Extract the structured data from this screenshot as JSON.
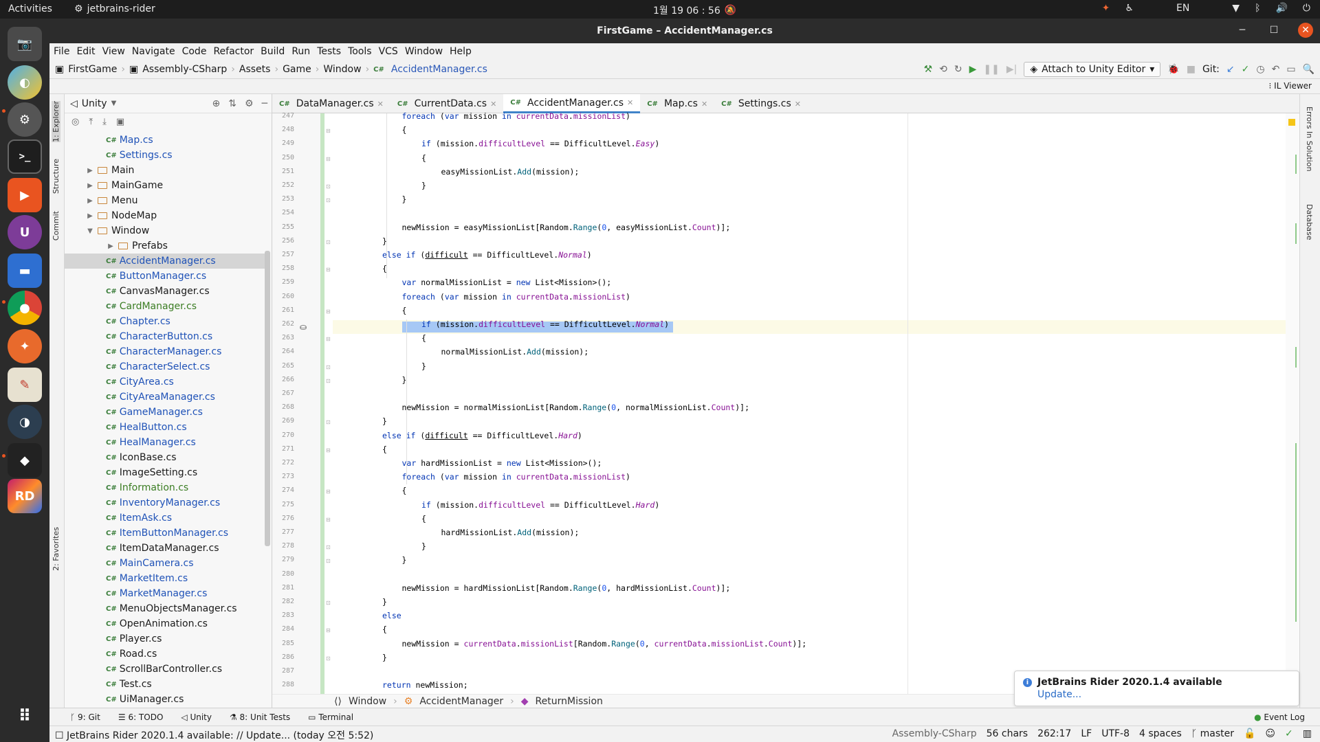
{
  "topbar": {
    "activities": "Activities",
    "app": "jetbrains-rider",
    "clock": "1월 19  06 : 56",
    "lang": "EN"
  },
  "window": {
    "title": "FirstGame – AccidentManager.cs"
  },
  "menu": [
    "File",
    "Edit",
    "View",
    "Navigate",
    "Code",
    "Refactor",
    "Build",
    "Run",
    "Tests",
    "Tools",
    "VCS",
    "Window",
    "Help"
  ],
  "nav": {
    "crumbs": [
      "FirstGame",
      "Assembly-CSharp",
      "Assets",
      "Game",
      "Window",
      "AccidentManager.cs"
    ],
    "attach": "Attach to Unity Editor",
    "git": "Git:",
    "il_viewer": "IL Viewer"
  },
  "left_stripe": [
    "1: Explorer",
    "Structure",
    "Commit",
    "2: Favorites"
  ],
  "project": {
    "view": "Unity",
    "tree": [
      {
        "name": "Map.cs",
        "type": "cs",
        "depth": 3,
        "status": "mod"
      },
      {
        "name": "Settings.cs",
        "type": "cs",
        "depth": 3,
        "status": "mod"
      },
      {
        "name": "Main",
        "type": "folder",
        "depth": 2,
        "arrow": "▶"
      },
      {
        "name": "MainGame",
        "type": "folder",
        "depth": 2,
        "arrow": "▶"
      },
      {
        "name": "Menu",
        "type": "folder",
        "depth": 2,
        "arrow": "▶"
      },
      {
        "name": "NodeMap",
        "type": "folder",
        "depth": 2,
        "arrow": "▶"
      },
      {
        "name": "Window",
        "type": "folder",
        "depth": 2,
        "arrow": "▼"
      },
      {
        "name": "Prefabs",
        "type": "folder",
        "depth": 3,
        "arrow": "▶"
      },
      {
        "name": "AccidentManager.cs",
        "type": "cs",
        "depth": 3,
        "status": "mod",
        "selected": true
      },
      {
        "name": "ButtonManager.cs",
        "type": "cs",
        "depth": 3,
        "status": "mod"
      },
      {
        "name": "CanvasManager.cs",
        "type": "cs",
        "depth": 3,
        "status": ""
      },
      {
        "name": "CardManager.cs",
        "type": "cs",
        "depth": 3,
        "status": "new"
      },
      {
        "name": "Chapter.cs",
        "type": "cs",
        "depth": 3,
        "status": "mod"
      },
      {
        "name": "CharacterButton.cs",
        "type": "cs",
        "depth": 3,
        "status": "mod"
      },
      {
        "name": "CharacterManager.cs",
        "type": "cs",
        "depth": 3,
        "status": "mod"
      },
      {
        "name": "CharacterSelect.cs",
        "type": "cs",
        "depth": 3,
        "status": "mod"
      },
      {
        "name": "CityArea.cs",
        "type": "cs",
        "depth": 3,
        "status": "mod"
      },
      {
        "name": "CityAreaManager.cs",
        "type": "cs",
        "depth": 3,
        "status": "mod"
      },
      {
        "name": "GameManager.cs",
        "type": "cs",
        "depth": 3,
        "status": "mod"
      },
      {
        "name": "HealButton.cs",
        "type": "cs",
        "depth": 3,
        "status": "mod"
      },
      {
        "name": "HealManager.cs",
        "type": "cs",
        "depth": 3,
        "status": "mod"
      },
      {
        "name": "IconBase.cs",
        "type": "cs",
        "depth": 3,
        "status": ""
      },
      {
        "name": "ImageSetting.cs",
        "type": "cs",
        "depth": 3,
        "status": ""
      },
      {
        "name": "Information.cs",
        "type": "cs",
        "depth": 3,
        "status": "new"
      },
      {
        "name": "InventoryManager.cs",
        "type": "cs",
        "depth": 3,
        "status": "mod"
      },
      {
        "name": "ItemAsk.cs",
        "type": "cs",
        "depth": 3,
        "status": "mod"
      },
      {
        "name": "ItemButtonManager.cs",
        "type": "cs",
        "depth": 3,
        "status": "mod"
      },
      {
        "name": "ItemDataManager.cs",
        "type": "cs",
        "depth": 3,
        "status": ""
      },
      {
        "name": "MainCamera.cs",
        "type": "cs",
        "depth": 3,
        "status": "mod"
      },
      {
        "name": "MarketItem.cs",
        "type": "cs",
        "depth": 3,
        "status": "mod"
      },
      {
        "name": "MarketManager.cs",
        "type": "cs",
        "depth": 3,
        "status": "mod"
      },
      {
        "name": "MenuObjectsManager.cs",
        "type": "cs",
        "depth": 3,
        "status": ""
      },
      {
        "name": "OpenAnimation.cs",
        "type": "cs",
        "depth": 3,
        "status": ""
      },
      {
        "name": "Player.cs",
        "type": "cs",
        "depth": 3,
        "status": ""
      },
      {
        "name": "Road.cs",
        "type": "cs",
        "depth": 3,
        "status": ""
      },
      {
        "name": "ScrollBarController.cs",
        "type": "cs",
        "depth": 3,
        "status": ""
      },
      {
        "name": "Test.cs",
        "type": "cs",
        "depth": 3,
        "status": ""
      },
      {
        "name": "UiManager.cs",
        "type": "cs",
        "depth": 3,
        "status": ""
      }
    ]
  },
  "tabs": [
    {
      "label": "DataManager.cs",
      "active": false
    },
    {
      "label": "CurrentData.cs",
      "active": false
    },
    {
      "label": "AccidentManager.cs",
      "active": true
    },
    {
      "label": "Map.cs",
      "active": false
    },
    {
      "label": "Settings.cs",
      "active": false
    }
  ],
  "code": {
    "lines": [
      {
        "n": "247",
        "indent": 1,
        "html": "<span class=\"kw\">foreach</span> (<span class=\"kw\">var</span> mission <span class=\"kw\">in</span> <span class=\"fld\">currentData</span>.<span class=\"fld\">missionList</span>)"
      },
      {
        "n": "248",
        "indent": 1,
        "html": "{"
      },
      {
        "n": "249",
        "indent": 2,
        "html": "<span class=\"kw\">if</span> (mission.<span class=\"fld\">difficultLevel</span> == DifficultLevel.<span class=\"enm\">Easy</span>)"
      },
      {
        "n": "250",
        "indent": 2,
        "html": "{"
      },
      {
        "n": "251",
        "indent": 3,
        "html": "easyMissionList.<span class=\"mth\">Add</span>(mission);"
      },
      {
        "n": "252",
        "indent": 2,
        "html": "}"
      },
      {
        "n": "253",
        "indent": 1,
        "html": "}"
      },
      {
        "n": "254",
        "indent": 0,
        "html": ""
      },
      {
        "n": "255",
        "indent": 1,
        "html": "newMission = easyMissionList[Random.<span class=\"mth\">Range</span>(<span class=\"num\">0</span>, easyMissionList.<span class=\"fld\">Count</span>)];"
      },
      {
        "n": "256",
        "indent": 0,
        "html": "}"
      },
      {
        "n": "257",
        "indent": 0,
        "html": "<span class=\"kw\">else if</span> (<span class=\"ul\">difficult</span> == DifficultLevel.<span class=\"enm\">Normal</span>)"
      },
      {
        "n": "258",
        "indent": 0,
        "html": "{"
      },
      {
        "n": "259",
        "indent": 1,
        "html": "<span class=\"kw\">var</span> normalMissionList = <span class=\"kw\">new</span> List&lt;Mission&gt;();"
      },
      {
        "n": "260",
        "indent": 1,
        "html": "<span class=\"kw\">foreach</span> (<span class=\"kw\">var</span> mission <span class=\"kw\">in</span> <span class=\"fld\">currentData</span>.<span class=\"fld\">missionList</span>)"
      },
      {
        "n": "261",
        "indent": 1,
        "html": "{"
      },
      {
        "n": "262",
        "indent": 2,
        "html": "<span class=\"kw\">if</span> (mission.<span class=\"fld\">difficultLevel</span> == DifficultLevel.<span class=\"enm\">Normal</span>)"
      },
      {
        "n": "263",
        "indent": 2,
        "html": "{"
      },
      {
        "n": "264",
        "indent": 3,
        "html": "normalMissionList.<span class=\"mth\">Add</span>(mission);"
      },
      {
        "n": "265",
        "indent": 2,
        "html": "}"
      },
      {
        "n": "266",
        "indent": 1,
        "html": "}"
      },
      {
        "n": "267",
        "indent": 0,
        "html": ""
      },
      {
        "n": "268",
        "indent": 1,
        "html": "newMission = normalMissionList[Random.<span class=\"mth\">Range</span>(<span class=\"num\">0</span>, normalMissionList.<span class=\"fld\">Count</span>)];"
      },
      {
        "n": "269",
        "indent": 0,
        "html": "}"
      },
      {
        "n": "270",
        "indent": 0,
        "html": "<span class=\"kw\">else if</span> (<span class=\"ul\">difficult</span> == DifficultLevel.<span class=\"enm\">Hard</span>)"
      },
      {
        "n": "271",
        "indent": 0,
        "html": "{"
      },
      {
        "n": "272",
        "indent": 1,
        "html": "<span class=\"kw\">var</span> hardMissionList = <span class=\"kw\">new</span> List&lt;Mission&gt;();"
      },
      {
        "n": "273",
        "indent": 1,
        "html": "<span class=\"kw\">foreach</span> (<span class=\"kw\">var</span> mission <span class=\"kw\">in</span> <span class=\"fld\">currentData</span>.<span class=\"fld\">missionList</span>)"
      },
      {
        "n": "274",
        "indent": 1,
        "html": "{"
      },
      {
        "n": "275",
        "indent": 2,
        "html": "<span class=\"kw\">if</span> (mission.<span class=\"fld\">difficultLevel</span> == DifficultLevel.<span class=\"enm\">Hard</span>)"
      },
      {
        "n": "276",
        "indent": 2,
        "html": "{"
      },
      {
        "n": "277",
        "indent": 3,
        "html": "hardMissionList.<span class=\"mth\">Add</span>(mission);"
      },
      {
        "n": "278",
        "indent": 2,
        "html": "}"
      },
      {
        "n": "279",
        "indent": 1,
        "html": "}"
      },
      {
        "n": "280",
        "indent": 0,
        "html": ""
      },
      {
        "n": "281",
        "indent": 1,
        "html": "newMission = hardMissionList[Random.<span class=\"mth\">Range</span>(<span class=\"num\">0</span>, hardMissionList.<span class=\"fld\">Count</span>)];"
      },
      {
        "n": "282",
        "indent": 0,
        "html": "}"
      },
      {
        "n": "283",
        "indent": 0,
        "html": "<span class=\"kw\">else</span>"
      },
      {
        "n": "284",
        "indent": 0,
        "html": "{"
      },
      {
        "n": "285",
        "indent": 1,
        "html": "newMission = <span class=\"fld\">currentData</span>.<span class=\"fld\">missionList</span>[Random.<span class=\"mth\">Range</span>(<span class=\"num\">0</span>, <span class=\"fld\">currentData</span>.<span class=\"fld\">missionList</span>.<span class=\"fld\">Count</span>)];"
      },
      {
        "n": "286",
        "indent": 0,
        "html": "}"
      },
      {
        "n": "287",
        "indent": 0,
        "html": ""
      },
      {
        "n": "288",
        "indent": 0,
        "html": "<span class=\"kw\">return</span> newMission;"
      }
    ]
  },
  "editor_crumbs": [
    "Window",
    "AccidentManager",
    "ReturnMission"
  ],
  "right_stripe": [
    "Errors In Solution",
    "Database"
  ],
  "notification": {
    "title": "JetBrains Rider 2020.1.4 available",
    "link": "Update..."
  },
  "toolwindows": [
    "9: Git",
    "6: TODO",
    "Unity",
    "8: Unit Tests",
    "Terminal"
  ],
  "event_log": "Event Log",
  "status": {
    "message": "JetBrains Rider 2020.1.4 available: // Update... (today 오전 5:52)",
    "project": "Assembly-CSharp",
    "chars": "56 chars",
    "pos": "262:17",
    "le": "LF",
    "enc": "UTF-8",
    "indent": "4 spaces",
    "branch": "master"
  },
  "colors": {
    "accent": "#e95420",
    "selection": "#a6c8f5",
    "current_line": "#fcfae6"
  }
}
